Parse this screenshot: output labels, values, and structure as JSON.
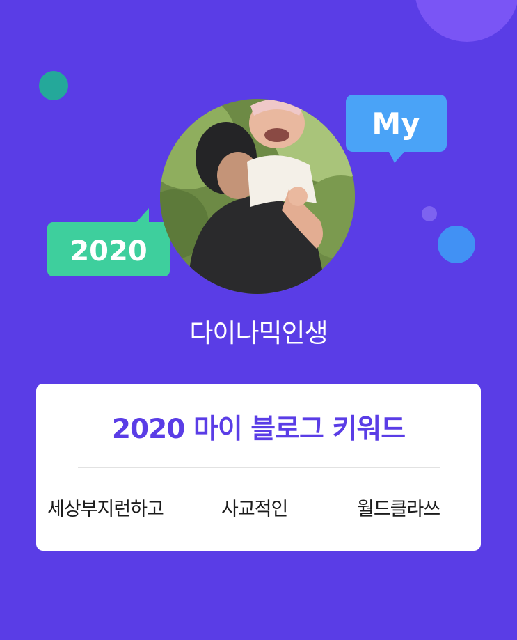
{
  "header": {
    "bubble_my_label": "My",
    "bubble_year_label": "2020"
  },
  "profile": {
    "nickname": "다이나믹인생"
  },
  "keyword_card": {
    "title": "2020 마이 블로그 키워드",
    "keywords": [
      "세상부지런하고",
      "사교적인",
      "월드클라쓰"
    ]
  },
  "colors": {
    "background": "#5a3de6",
    "accent_title": "#5a3de6",
    "bubble_my": "#4aa3f7",
    "bubble_year": "#3ecf9d",
    "card": "#ffffff"
  },
  "icons": {
    "avatar": "profile-photo"
  }
}
